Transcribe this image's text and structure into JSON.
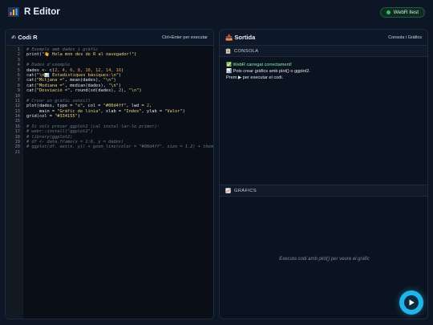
{
  "app": {
    "title": "R Editor",
    "status_badge": "WebR llest"
  },
  "editor": {
    "header_title": "✍ Codi R",
    "shortcut_hint": "Ctrl+Enter per executar",
    "lines": [
      {
        "n": "1",
        "tokens": [
          {
            "t": "# Exemple amb dades i gràfic",
            "c": "cm"
          }
        ]
      },
      {
        "n": "2",
        "tokens": [
          {
            "t": "print(",
            "c": "fn"
          },
          {
            "t": "\"👋 Hola món des de R al navegador!\"",
            "c": "st"
          },
          {
            "t": ")",
            "c": "fn"
          }
        ]
      },
      {
        "n": "3",
        "tokens": []
      },
      {
        "n": "4",
        "tokens": [
          {
            "t": "# Dades d'exemple",
            "c": "cm"
          }
        ]
      },
      {
        "n": "5",
        "tokens": [
          {
            "t": "dades <- c(",
            "c": "fn"
          },
          {
            "t": "2, 4, 6, 8, 10, 12, 14, 16",
            "c": "nm"
          },
          {
            "t": ")",
            "c": "fn"
          }
        ]
      },
      {
        "n": "6",
        "tokens": [
          {
            "t": "cat(",
            "c": "fn"
          },
          {
            "t": "\"\\n📊 Estadístiques bàsiques:\\n\"",
            "c": "st"
          },
          {
            "t": ")",
            "c": "fn"
          }
        ]
      },
      {
        "n": "7",
        "tokens": [
          {
            "t": "cat(",
            "c": "fn"
          },
          {
            "t": "\"Mitjana =\"",
            "c": "st"
          },
          {
            "t": ", mean(dades), ",
            "c": "fn"
          },
          {
            "t": "\"\\n\"",
            "c": "st"
          },
          {
            "t": ")",
            "c": "fn"
          }
        ]
      },
      {
        "n": "8",
        "tokens": [
          {
            "t": "cat(",
            "c": "fn"
          },
          {
            "t": "\"Mediana =\"",
            "c": "st"
          },
          {
            "t": ", median(dades), ",
            "c": "fn"
          },
          {
            "t": "\"\\n\"",
            "c": "st"
          },
          {
            "t": ")",
            "c": "fn"
          }
        ]
      },
      {
        "n": "9",
        "tokens": [
          {
            "t": "cat(",
            "c": "fn"
          },
          {
            "t": "\"Desviació =\"",
            "c": "st"
          },
          {
            "t": ", round(sd(dades), ",
            "c": "fn"
          },
          {
            "t": "2",
            "c": "nm"
          },
          {
            "t": "), ",
            "c": "fn"
          },
          {
            "t": "\"\\n\"",
            "c": "st"
          },
          {
            "t": ")",
            "c": "fn"
          }
        ]
      },
      {
        "n": "10",
        "tokens": []
      },
      {
        "n": "11",
        "tokens": [
          {
            "t": "# Crear un gràfic senzill",
            "c": "cm"
          }
        ]
      },
      {
        "n": "12",
        "tokens": [
          {
            "t": "plot(dades, type = ",
            "c": "fn"
          },
          {
            "t": "\"o\"",
            "c": "st"
          },
          {
            "t": ", col = ",
            "c": "fn"
          },
          {
            "t": "\"#00d4ff\"",
            "c": "st"
          },
          {
            "t": ", lwd = ",
            "c": "fn"
          },
          {
            "t": "2",
            "c": "nm"
          },
          {
            "t": ",",
            "c": "fn"
          }
        ]
      },
      {
        "n": "13",
        "tokens": [
          {
            "t": "     main = ",
            "c": "fn"
          },
          {
            "t": "\"Gràfic de línia\"",
            "c": "st"
          },
          {
            "t": ", xlab = ",
            "c": "fn"
          },
          {
            "t": "\"Índex\"",
            "c": "st"
          },
          {
            "t": ", ylab = ",
            "c": "fn"
          },
          {
            "t": "\"Valor\"",
            "c": "st"
          },
          {
            "t": ")",
            "c": "fn"
          }
        ]
      },
      {
        "n": "14",
        "tokens": [
          {
            "t": "grid(col = ",
            "c": "fn"
          },
          {
            "t": "\"#334155\"",
            "c": "st"
          },
          {
            "t": ")",
            "c": "fn"
          }
        ]
      },
      {
        "n": "15",
        "tokens": []
      },
      {
        "n": "16",
        "tokens": [
          {
            "t": "# Si vols provar ggplot2 (cal instal·lar-lo primer):",
            "c": "cm"
          }
        ]
      },
      {
        "n": "17",
        "tokens": [
          {
            "t": "# webr::install(\"ggplot2\")",
            "c": "cm"
          }
        ]
      },
      {
        "n": "18",
        "tokens": [
          {
            "t": "# library(ggplot2)",
            "c": "cm"
          }
        ]
      },
      {
        "n": "19",
        "tokens": [
          {
            "t": "# df <- data.frame(x = 1:8, y = dades)",
            "c": "cm"
          }
        ]
      },
      {
        "n": "20",
        "tokens": [
          {
            "t": "# ggplot(df, aes(x, y)) + geom_line(color = \"#00d4ff\", size = 1.2) + theme_minimal()",
            "c": "cm"
          }
        ]
      },
      {
        "n": "21",
        "tokens": []
      }
    ]
  },
  "output": {
    "header_title": "📤 Sortida",
    "header_hint": "Consola i Gràfics",
    "console_label": "CONSOLA",
    "console_lines": [
      {
        "text": "✅ WebR carregat correctament!",
        "kind": "ok"
      },
      {
        "text": "📊 Pots crear gràfics amb plot() o ggplot2.",
        "kind": "normal"
      },
      {
        "text": "Prem ▶ per executar el codi.",
        "kind": "normal"
      }
    ],
    "graphs_label": "GRÀFICS",
    "graphs_placeholder": "Executa codi amb plot() per veure el gràfic"
  },
  "colors": {
    "accent": "#1fb5e6",
    "background": "#0d1624",
    "status_dot": "#22c55e"
  },
  "icons": {
    "app": "bar-chart-icon",
    "console": "clipboard-icon",
    "graphs": "chart-icon",
    "run": "play-icon"
  }
}
